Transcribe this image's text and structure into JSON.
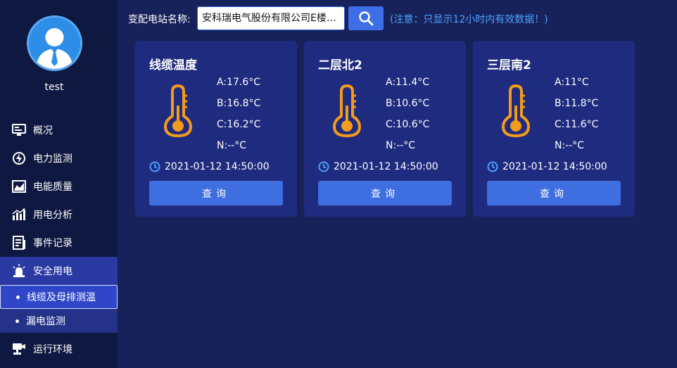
{
  "user": {
    "name": "test"
  },
  "sidebar": {
    "items": [
      {
        "label": "概况",
        "icon": "monitor-icon"
      },
      {
        "label": "电力监测",
        "icon": "lightning-icon"
      },
      {
        "label": "电能质量",
        "icon": "area-chart-icon"
      },
      {
        "label": "用电分析",
        "icon": "bar-chart-icon"
      },
      {
        "label": "事件记录",
        "icon": "document-icon"
      },
      {
        "label": "安全用电",
        "icon": "alarm-light-icon"
      },
      {
        "label": "运行环境",
        "icon": "camera-icon"
      }
    ],
    "sub_items": [
      {
        "label": "线缆及母排测温"
      },
      {
        "label": "漏电监测"
      }
    ]
  },
  "topbar": {
    "station_label": "变配电站名称:",
    "station_value": "安科瑞电气股份有限公司E楼…",
    "notice": "(注意：只显示12小时内有效数据！)"
  },
  "cards": [
    {
      "title": "线缆温度",
      "a": "A:17.6°C",
      "b": "B:16.8°C",
      "c": "C:16.2°C",
      "n": "N:--°C",
      "time": "2021-01-12 14:50:00",
      "button": "查询"
    },
    {
      "title": "二层北2",
      "a": "A:11.4°C",
      "b": "B:10.6°C",
      "c": "C:10.6°C",
      "n": "N:--°C",
      "time": "2021-01-12 14:50:00",
      "button": "查询"
    },
    {
      "title": "三层南2",
      "a": "A:11°C",
      "b": "B:11.8°C",
      "c": "C:11.6°C",
      "n": "N:--°C",
      "time": "2021-01-12 14:50:00",
      "button": "查询"
    }
  ],
  "colors": {
    "background": "#18225a",
    "sidebar": "#0f1840",
    "card": "#1f2b7e",
    "accent": "#3f6ee0",
    "thermometer": "#f29b1d",
    "notice": "#4ba3ff"
  }
}
